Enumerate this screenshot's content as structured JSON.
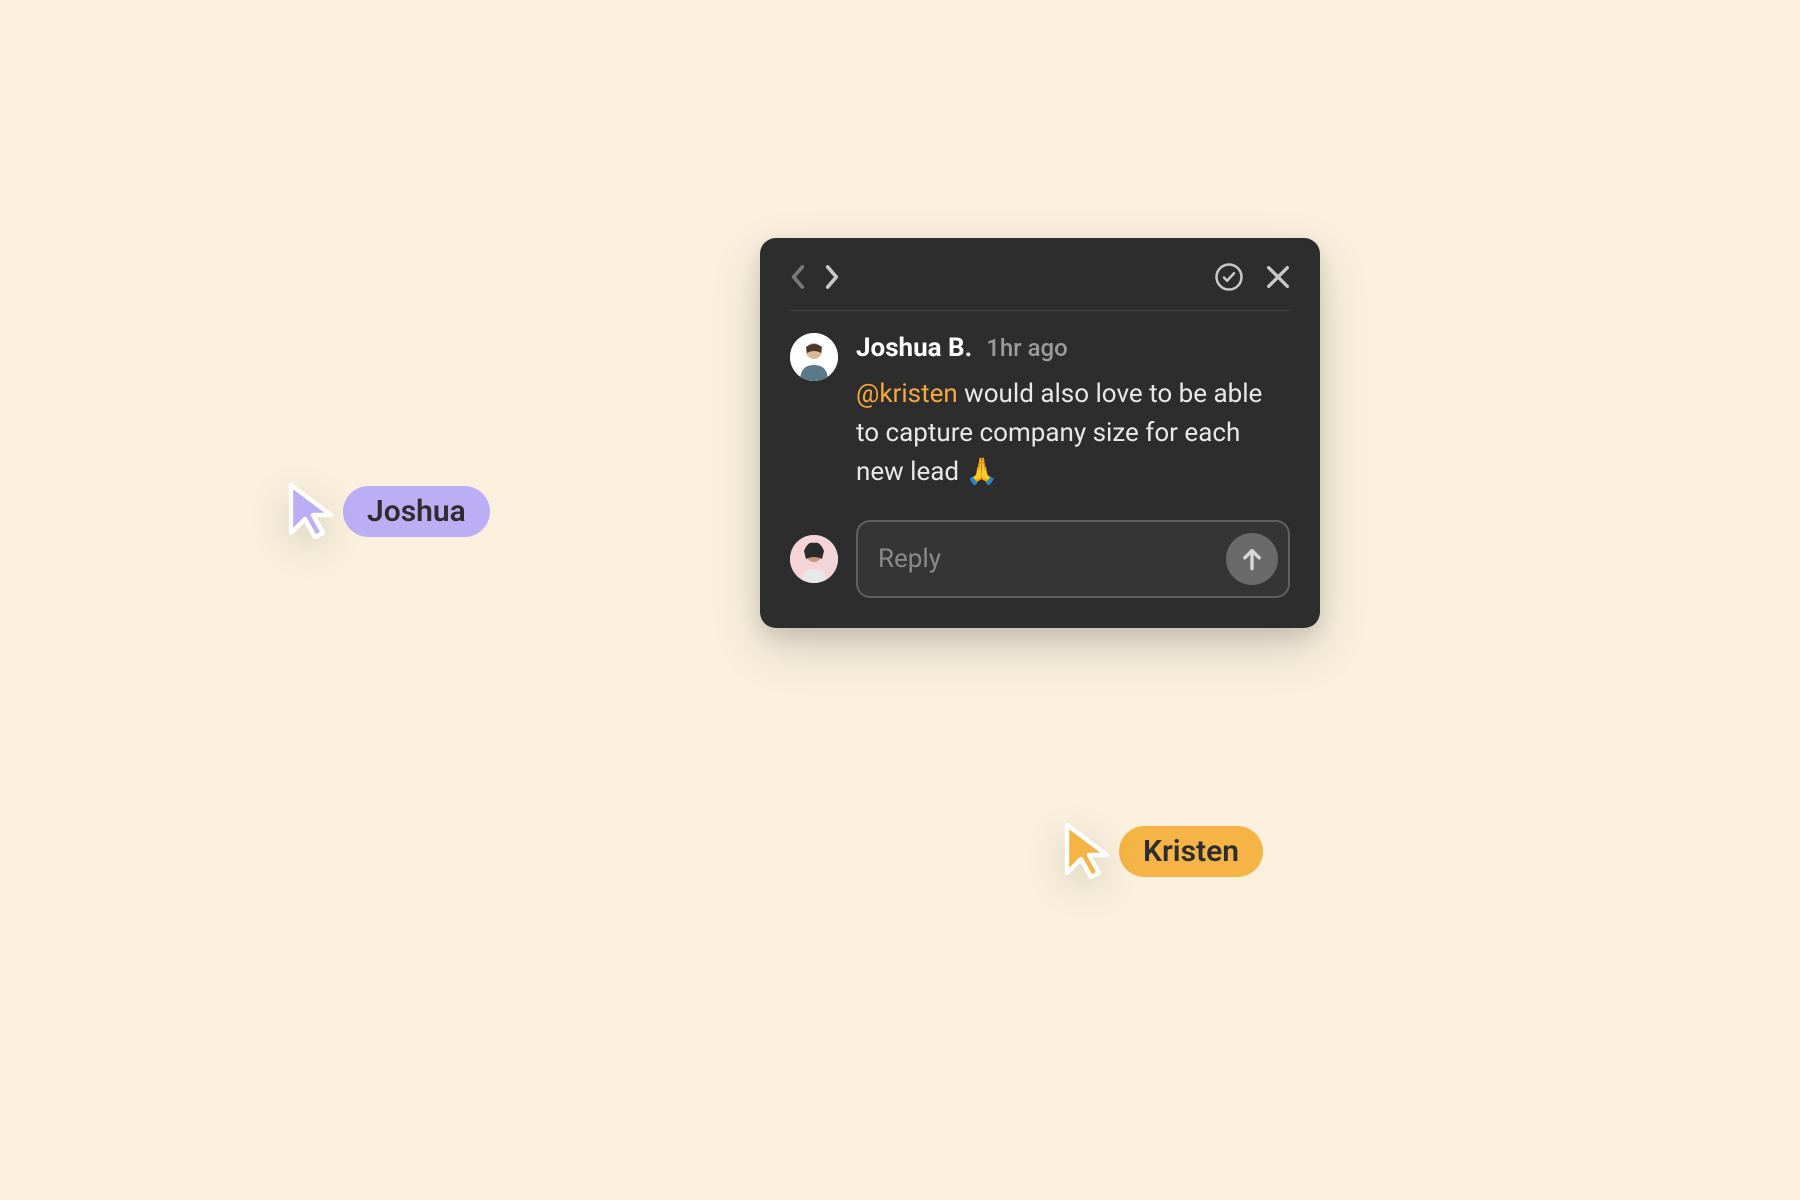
{
  "popup": {
    "author": "Joshua B.",
    "timestamp": "1hr ago",
    "mention": "@kristen",
    "message": " would also love to be able to capture company size for each new lead 🙏",
    "reply_placeholder": "Reply"
  },
  "cursors": {
    "joshua": {
      "label": "Joshua",
      "color": "#bbaef5"
    },
    "kristen": {
      "label": "Kristen",
      "color": "#f5b445"
    }
  }
}
